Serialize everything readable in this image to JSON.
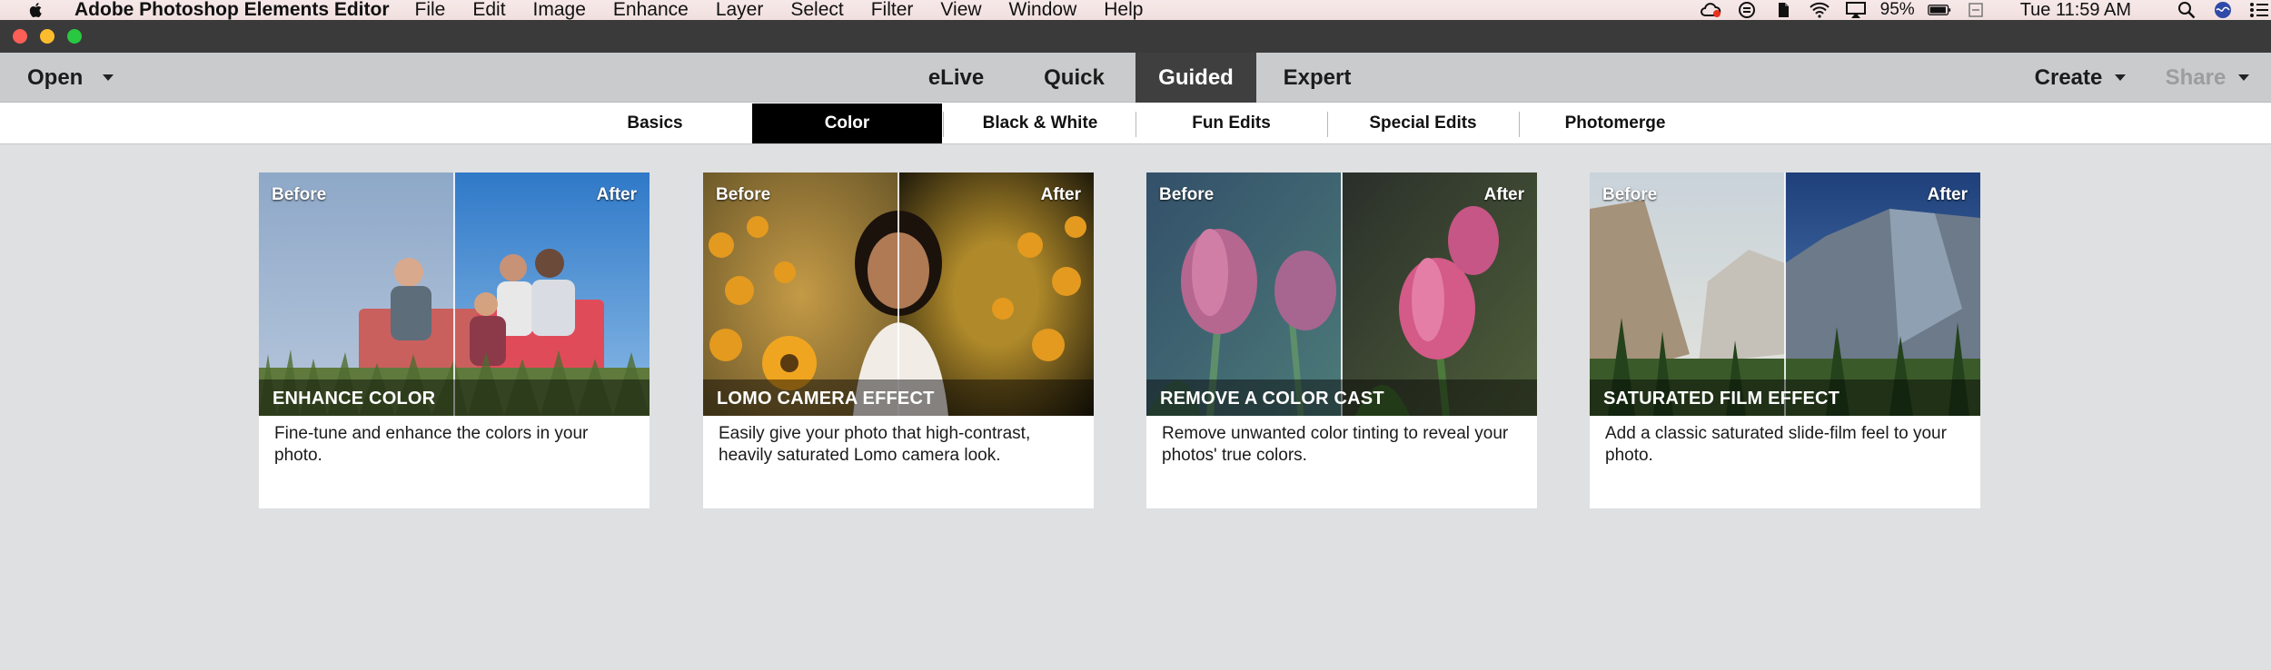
{
  "menubar": {
    "app_name": "Adobe Photoshop Elements Editor",
    "menus": [
      "File",
      "Edit",
      "Image",
      "Enhance",
      "Layer",
      "Select",
      "Filter",
      "View",
      "Window",
      "Help"
    ],
    "battery": "95%",
    "clock": "Tue 11:59 AM",
    "status_icons": [
      "creative-cloud-icon",
      "sync-icon",
      "evernote-icon",
      "wifi-icon",
      "airplay-icon",
      "battery-icon",
      "spotlight-icon",
      "siri-icon",
      "notification-center-icon"
    ]
  },
  "modebar": {
    "open_label": "Open",
    "modes": [
      "eLive",
      "Quick",
      "Guided",
      "Expert"
    ],
    "active_mode": "Guided",
    "create_label": "Create",
    "share_label": "Share"
  },
  "subtabs": {
    "items": [
      "Basics",
      "Color",
      "Black & White",
      "Fun Edits",
      "Special Edits",
      "Photomerge"
    ],
    "active": "Color"
  },
  "cards": [
    {
      "before": "Before",
      "after": "After",
      "title": "ENHANCE COLOR",
      "description": "Fine-tune and enhance the colors in your photo."
    },
    {
      "before": "Before",
      "after": "After",
      "title": "LOMO CAMERA EFFECT",
      "description": "Easily give your photo that high-contrast, heavily saturated Lomo camera look."
    },
    {
      "before": "Before",
      "after": "After",
      "title": "REMOVE A COLOR CAST",
      "description": "Remove unwanted color tinting to reveal your photos' true colors."
    },
    {
      "before": "Before",
      "after": "After",
      "title": "SATURATED FILM EFFECT",
      "description": "Add a classic saturated slide-film feel to your photo."
    }
  ],
  "colors": {
    "active_mode_bg": "#3f3f3f",
    "active_tab_bg": "#000000",
    "workspace_bg": "#dfe0e2"
  }
}
